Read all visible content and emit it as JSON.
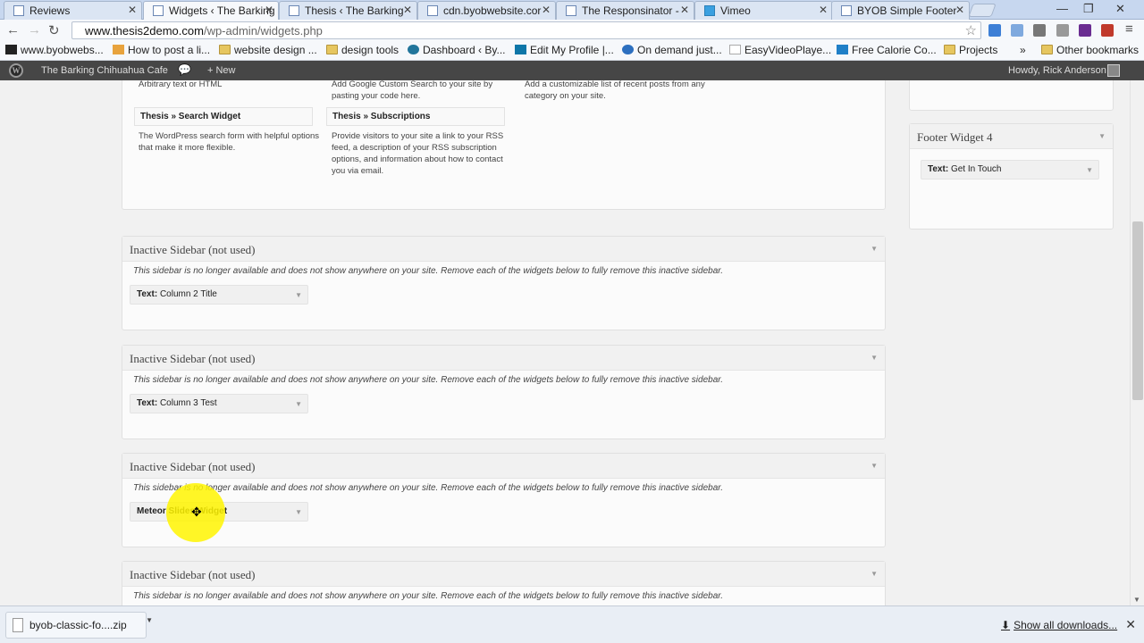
{
  "browser": {
    "tabs": [
      {
        "label": "Reviews",
        "active": false
      },
      {
        "label": "Widgets ‹ The Barking",
        "active": true
      },
      {
        "label": "Thesis ‹ The Barking",
        "active": false
      },
      {
        "label": "cdn.byobwebsite.cor",
        "active": false
      },
      {
        "label": "The Responsinator -",
        "active": false
      },
      {
        "label": "Vimeo",
        "active": false
      },
      {
        "label": "BYOB Simple Footer",
        "active": false
      }
    ],
    "url_domain": "www.thesis2demo.com",
    "url_path": "/wp-admin/widgets.php",
    "bookmarks": [
      "www.byobwebs...",
      "How to post a li...",
      "website design ...",
      "design tools",
      "Dashboard ‹ By...",
      "Edit My Profile |...",
      "On demand just...",
      "EasyVideoPlaye...",
      "Free Calorie Co...",
      "Projects"
    ],
    "bookmarks_overflow": "»",
    "other_bookmarks": "Other bookmarks"
  },
  "adminbar": {
    "site_name": "The Barking Chihuahua Cafe",
    "new_label": "New",
    "howdy": "Howdy, Rick Anderson"
  },
  "available_widgets": {
    "top_fragments": [
      "Arbitrary text or HTML",
      "Add Google Custom Search to your site by pasting your code here.",
      "Add a customizable list of recent posts from any category on your site."
    ],
    "items": [
      {
        "title": "Thesis » Search Widget",
        "desc": "The WordPress search form with helpful options that make it more flexible."
      },
      {
        "title": "Thesis » Subscriptions",
        "desc": "Provide visitors to your site a link to your RSS feed, a description of your RSS subscription options, and information about how to contact you via email."
      }
    ]
  },
  "inactive_sidebars": [
    {
      "title": "Inactive Sidebar (not used)",
      "note": "This sidebar is no longer available and does not show anywhere on your site. Remove each of the widgets below to fully remove this inactive sidebar.",
      "widget_type": "Text:",
      "widget_name": "Column 2 Title"
    },
    {
      "title": "Inactive Sidebar (not used)",
      "note": "This sidebar is no longer available and does not show anywhere on your site. Remove each of the widgets below to fully remove this inactive sidebar.",
      "widget_type": "Text:",
      "widget_name": "Column 3 Test"
    },
    {
      "title": "Inactive Sidebar (not used)",
      "note": "This sidebar is no longer available and does not show anywhere on your site. Remove each of the widgets below to fully remove this inactive sidebar.",
      "widget_type": "",
      "widget_name": "Meteor Slides Widget"
    },
    {
      "title": "Inactive Sidebar (not used)",
      "note": "This sidebar is no longer available and does not show anywhere on your site. Remove each of the widgets below to fully remove this inactive sidebar.",
      "widget_type": "",
      "widget_name": ""
    }
  ],
  "footer_widget_4": {
    "title": "Footer Widget 4",
    "widget_type": "Text:",
    "widget_name": "Get In Touch"
  },
  "downloads": {
    "file": "byob-classic-fo....zip",
    "show_all": "Show all downloads..."
  }
}
